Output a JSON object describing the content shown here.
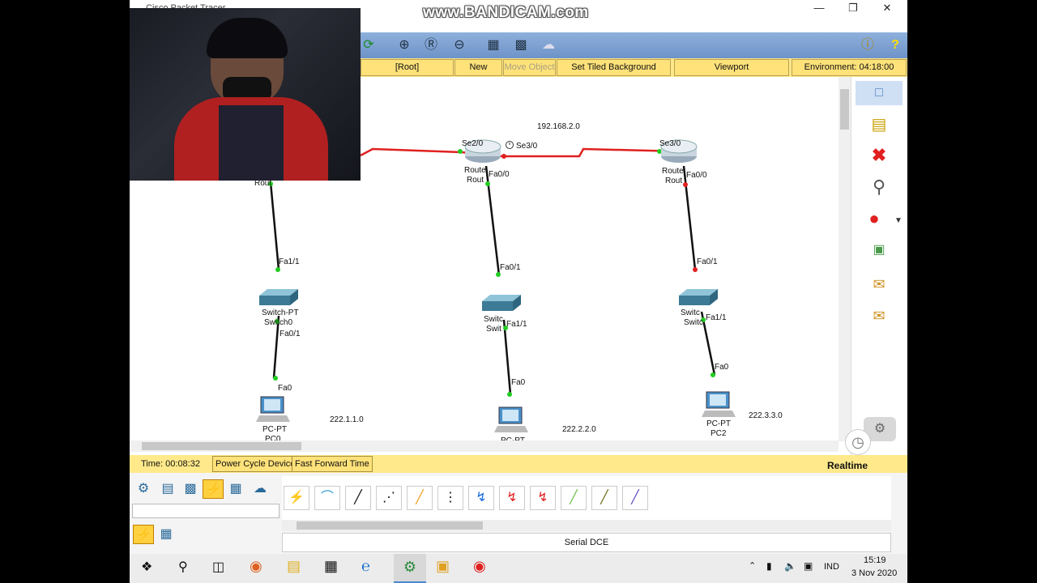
{
  "window": {
    "title": "Cisco Packet Tracer",
    "watermark": "www.BANDICAM.com"
  },
  "logical_bar": {
    "root": "[Root]",
    "new_cluster": "New Cluster",
    "move_object": "Move Object",
    "tiled_bg": "Set Tiled Background",
    "viewport": "Viewport",
    "environment": "Environment: 04:18:00"
  },
  "topology": {
    "net_top": "192.168.2.0",
    "net_left": "222.1.1.0",
    "net_mid": "222.2.2.0",
    "net_right": "222.3.3.0",
    "ports": {
      "se2_0": "Se2/0",
      "se3_0a": "Se3/0",
      "se3_0b": "Se3/0",
      "fa0_0a": "Fa0/0",
      "fa0_0b": "Fa0/0",
      "fa1_1a": "Fa1/1",
      "fa0_1a": "Fa0/1",
      "fa0_1b": "Fa0/1",
      "fa1_1b": "Fa1/1",
      "fa0_1c": "Fa0/1",
      "fa1_1c": "Fa1/1",
      "fa0a": "Fa0",
      "fa0b": "Fa0",
      "fa0c": "Fa0"
    },
    "devices": {
      "r_left": "Rout",
      "r_mid1": "Route",
      "r_mid2": "Rout",
      "r_right1": "Route",
      "r_right2": "Rout",
      "sw0a": "Switch-PT",
      "sw0b": "Switch0",
      "sw1a": "Switc",
      "sw1b": "Swit",
      "sw2a": "Switc",
      "sw2b": "Switc",
      "pc0a": "PC-PT",
      "pc0b": "PC0",
      "pc1a": "PC-PT",
      "pc2a": "PC-PT",
      "pc2b": "PC2"
    }
  },
  "timebar": {
    "time": "Time: 00:08:32",
    "power_cycle": "Power Cycle Devices",
    "fast_forward": "Fast Forward Time",
    "mode": "Realtime"
  },
  "bottom": {
    "selected_cable": "Serial DCE"
  },
  "taskbar": {
    "lang": "IND",
    "time": "15:19",
    "date": "3 Nov 2020"
  },
  "colors": {
    "toolbar": "#7a9dd0",
    "yellow": "#ffe98a",
    "serial_red": "#e02020",
    "link_green": "#22cc22"
  }
}
